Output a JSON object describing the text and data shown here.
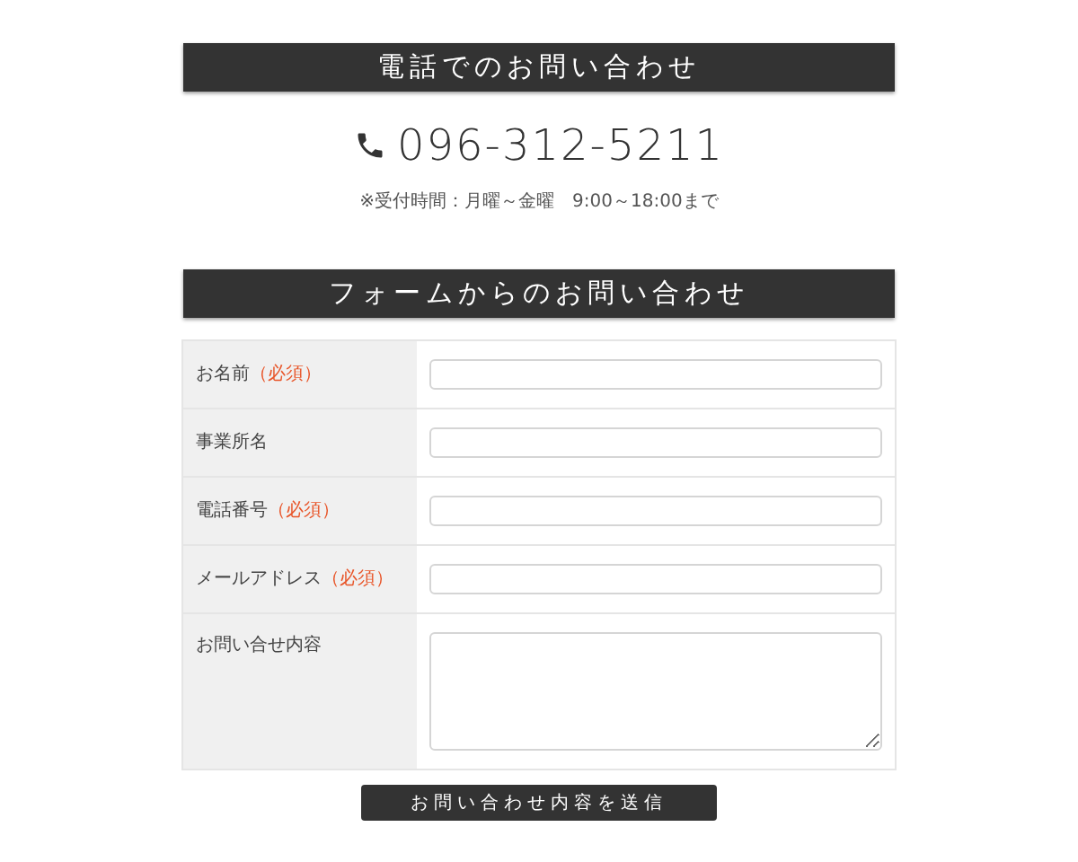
{
  "phone_section": {
    "heading": "電話でのお問い合わせ",
    "phone_number": "096-312-5211",
    "hours_note": "※受付時間：月曜～金曜　9:00～18:00まで"
  },
  "form_section": {
    "heading": "フォームからのお問い合わせ",
    "fields": [
      {
        "label": "お名前",
        "required_mark": "（必須）",
        "kind": "text"
      },
      {
        "label": "事業所名",
        "kind": "text"
      },
      {
        "label": "電話番号",
        "required_mark": "（必須）",
        "kind": "text"
      },
      {
        "label": "メールアドレス",
        "required_mark": "（必須）",
        "kind": "text"
      },
      {
        "label": "お問い合せ内容",
        "kind": "textarea"
      }
    ],
    "submit_button": "お問い合わせ内容を送信"
  }
}
